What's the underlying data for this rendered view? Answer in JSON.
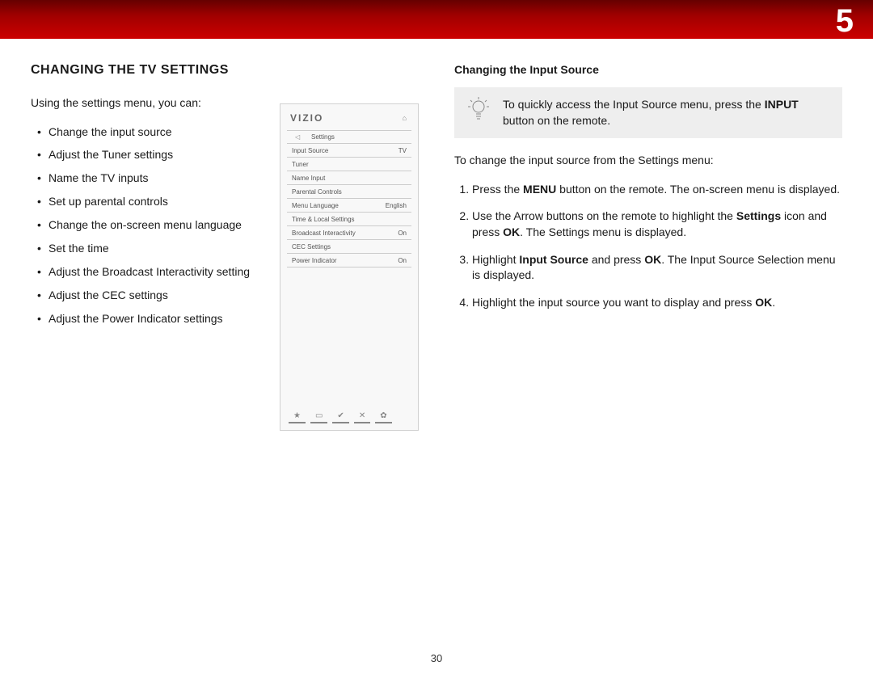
{
  "chapter": "5",
  "heading": "CHANGING THE TV SETTINGS",
  "intro": "Using the settings menu, you can:",
  "bullets": [
    "Change the input source",
    "Adjust the Tuner settings",
    "Name the TV inputs",
    "Set up parental controls",
    "Change the on-screen menu language",
    "Set the time",
    "Adjust the Broadcast Interactivity setting",
    "Adjust the CEC settings",
    "Adjust the Power Indicator settings"
  ],
  "menu": {
    "brand": "VIZIO",
    "title": "Settings",
    "rows": [
      {
        "label": "Input Source",
        "value": "TV"
      },
      {
        "label": "Tuner",
        "value": ""
      },
      {
        "label": "Name Input",
        "value": ""
      },
      {
        "label": "Parental Controls",
        "value": ""
      },
      {
        "label": "Menu Language",
        "value": "English"
      },
      {
        "label": "Time & Local Settings",
        "value": ""
      },
      {
        "label": "Broadcast Interactivity",
        "value": "On"
      },
      {
        "label": "CEC Settings",
        "value": ""
      },
      {
        "label": "Power Indicator",
        "value": "On"
      }
    ]
  },
  "right": {
    "heading": "Changing the Input Source",
    "tip_pre": "To quickly access the Input Source menu, press the ",
    "tip_bold": "INPUT",
    "tip_post": " button on the remote.",
    "intro": "To change the input source from the Settings menu:",
    "steps": {
      "s1a": "Press the ",
      "s1b": "MENU",
      "s1c": " button on the remote. The on-screen menu is displayed.",
      "s2a": "Use the Arrow buttons on the remote to highlight the ",
      "s2b": "Settings",
      "s2c": " icon and press ",
      "s2d": "OK",
      "s2e": ". The Settings menu is displayed.",
      "s3a": "Highlight ",
      "s3b": "Input Source",
      "s3c": " and press ",
      "s3d": "OK",
      "s3e": ". The Input Source Selection menu is displayed.",
      "s4a": "Highlight the input source you want to display and press ",
      "s4b": "OK",
      "s4c": "."
    }
  },
  "page_num": "30"
}
